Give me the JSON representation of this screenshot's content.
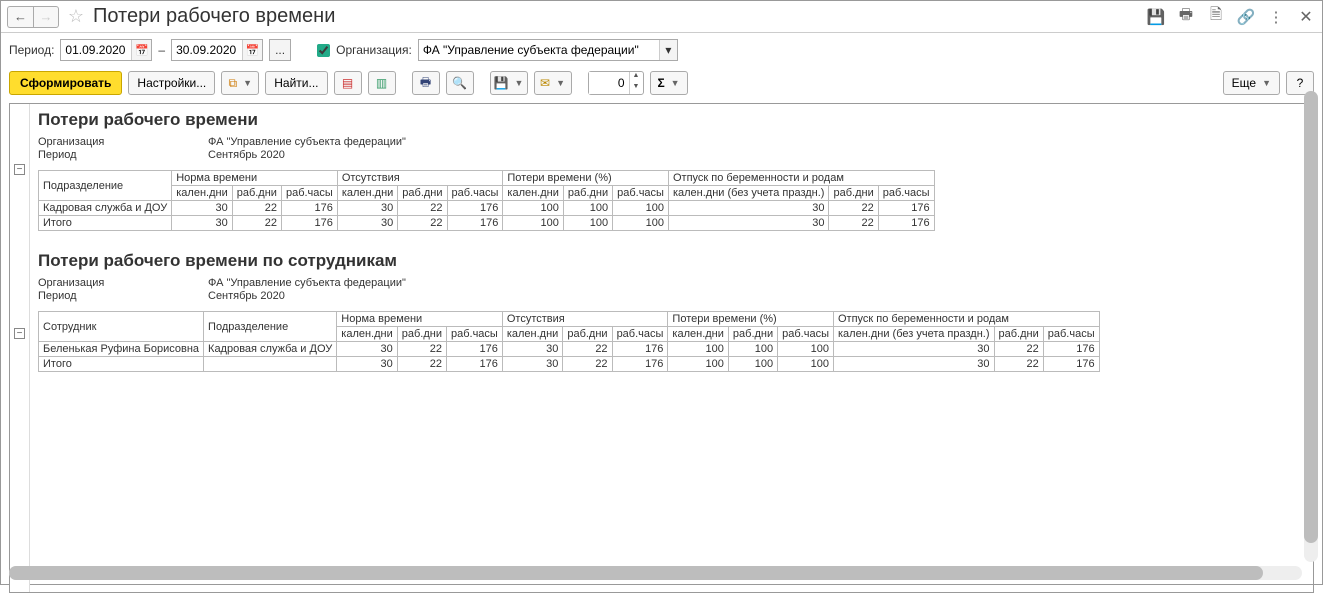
{
  "title": "Потери рабочего времени",
  "filters": {
    "period_label": "Период:",
    "date_from": "01.09.2020",
    "date_to": "30.09.2020",
    "dash": "–",
    "org_label": "Организация:",
    "org_value": "ФА \"Управление субъекта федерации\""
  },
  "toolbar": {
    "form": "Сформировать",
    "settings": "Настройки...",
    "find": "Найти...",
    "spin_value": "0",
    "more": "Еще",
    "help": "?"
  },
  "report1": {
    "title": "Потери рабочего времени",
    "org_label": "Организация",
    "org_value": "ФА \"Управление субъекта федерации\"",
    "period_label": "Период",
    "period_value": "Сентябрь 2020",
    "headers": {
      "col1": "Подразделение",
      "g1": "Норма времени",
      "g2": "Отсутствия",
      "g3": "Потери времени (%)",
      "g4": "Отпуск по беременности и родам",
      "s_kal": "кален.дни",
      "s_rabd": "раб.дни",
      "s_rabch": "раб.часы",
      "s_kal_np": "кален.дни (без учета праздн.)"
    },
    "rows": [
      {
        "name": "Кадровая служба и ДОУ",
        "v": [
          30,
          22,
          176,
          30,
          22,
          176,
          100,
          100,
          100,
          30,
          22,
          176
        ]
      },
      {
        "name": "Итого",
        "v": [
          30,
          22,
          176,
          30,
          22,
          176,
          100,
          100,
          100,
          30,
          22,
          176
        ]
      }
    ]
  },
  "report2": {
    "title": "Потери рабочего времени по сотрудникам",
    "org_label": "Организация",
    "org_value": "ФА \"Управление субъекта федерации\"",
    "period_label": "Период",
    "period_value": "Сентябрь 2020",
    "headers": {
      "col1": "Сотрудник",
      "col2": "Подразделение",
      "g1": "Норма времени",
      "g2": "Отсутствия",
      "g3": "Потери времени (%)",
      "g4": "Отпуск по беременности и родам",
      "s_kal": "кален.дни",
      "s_rabd": "раб.дни",
      "s_rabch": "раб.часы",
      "s_kal_np": "кален.дни (без учета праздн.)"
    },
    "rows": [
      {
        "name": "Беленькая Руфина Борисовна",
        "dept": "Кадровая служба и ДОУ",
        "v": [
          30,
          22,
          176,
          30,
          22,
          176,
          100,
          100,
          100,
          30,
          22,
          176
        ]
      },
      {
        "name": "Итого",
        "dept": "",
        "v": [
          30,
          22,
          176,
          30,
          22,
          176,
          100,
          100,
          100,
          30,
          22,
          176
        ]
      }
    ]
  }
}
